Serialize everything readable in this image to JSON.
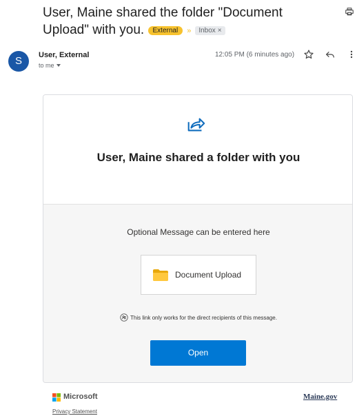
{
  "email": {
    "subject": "User, Maine shared the folder \"Document Upload\" with you.",
    "labels": {
      "external": "External",
      "inbox": "Inbox",
      "inbox_close": "×"
    },
    "sender": {
      "avatar_letter": "S",
      "name": "User, External",
      "recipient": "to me"
    },
    "timestamp": "12:05 PM (6 minutes ago)"
  },
  "card": {
    "title": "User, Maine shared a folder with you",
    "optional_message": "Optional Message can be entered here",
    "folder_name": "Document Upload",
    "notice": "This link only works for the direct recipients of this message.",
    "open_button": "Open"
  },
  "footer": {
    "microsoft": "Microsoft",
    "privacy": "Privacy Statement",
    "mainegov": "Maine.gov"
  },
  "icons": {
    "print": "print-icon",
    "star": "star-icon",
    "reply": "reply-icon",
    "more": "more-vert-icon",
    "share": "share-icon",
    "folder": "folder-icon",
    "notice": "people-icon",
    "microsoft_logo": "microsoft-logo-icon"
  },
  "colors": {
    "avatar": "#1a57a6",
    "external_label": "#f7c22e",
    "open_button": "#0078d4",
    "folder": "#ffc83d"
  }
}
